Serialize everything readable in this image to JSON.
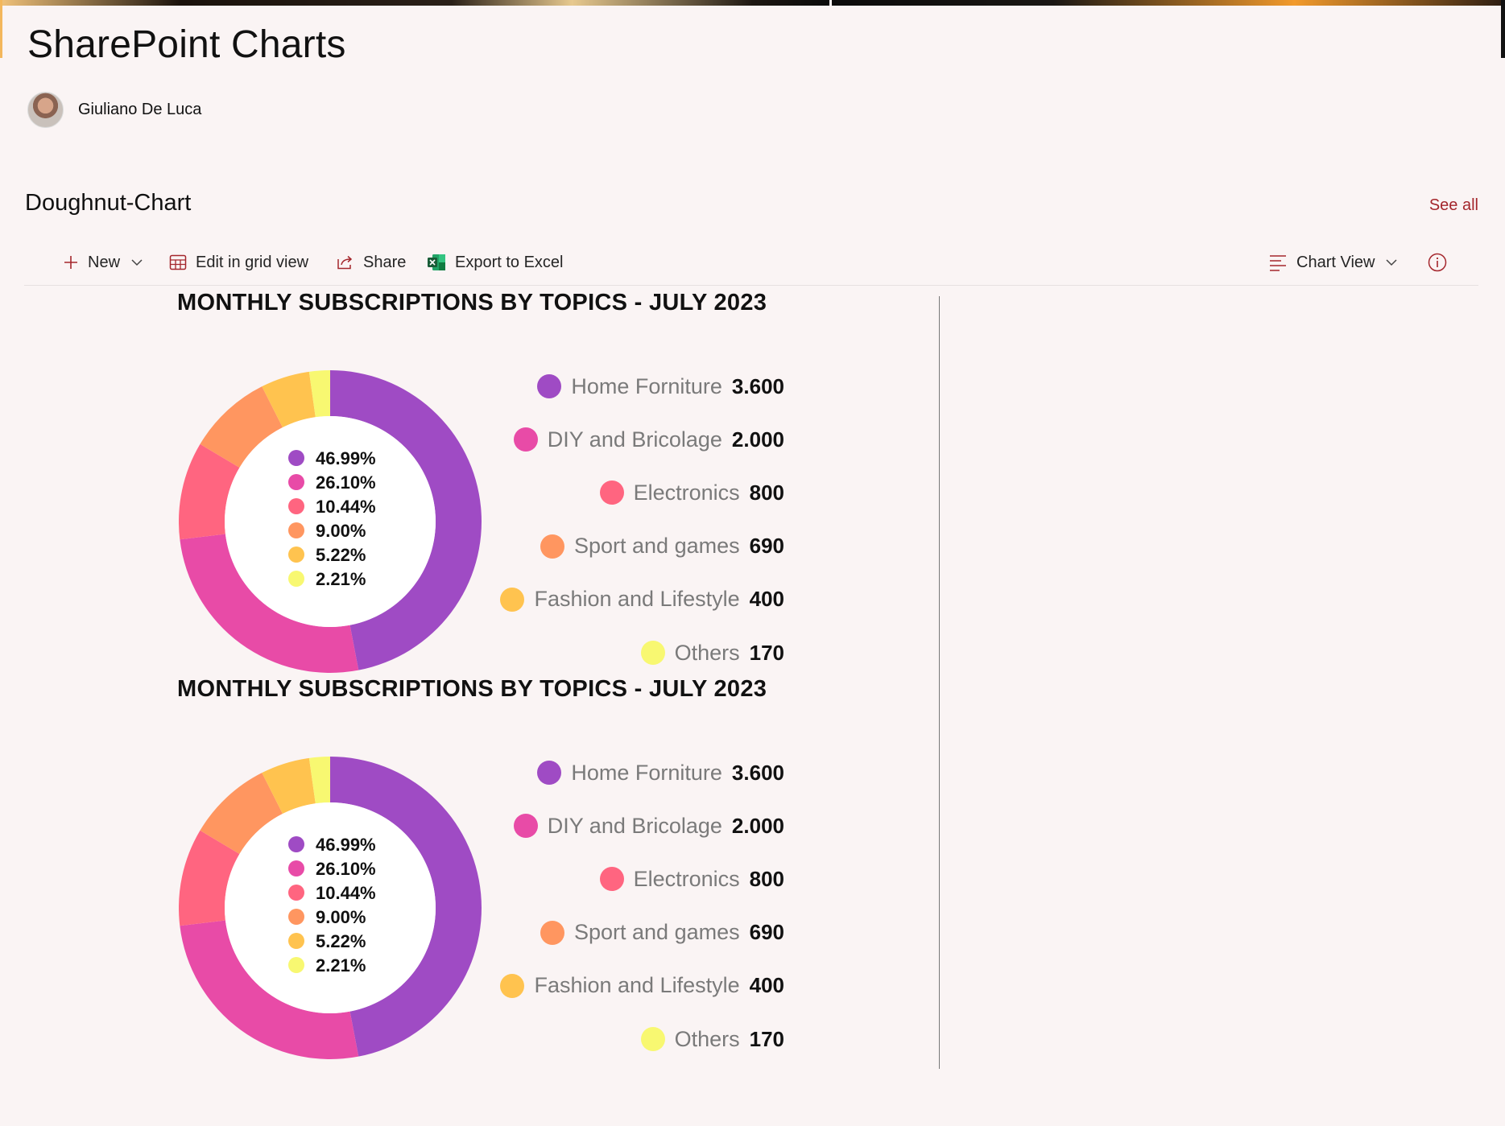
{
  "page": {
    "title": "SharePoint Charts",
    "author": "Giuliano De Luca"
  },
  "section": {
    "title": "Doughnut-Chart",
    "see_all": "See all"
  },
  "toolbar": {
    "new_label": "New",
    "edit_grid_label": "Edit in grid view",
    "share_label": "Share",
    "export_label": "Export to Excel",
    "view_label": "Chart View"
  },
  "icons": {
    "new": "plus-icon",
    "edit_grid": "grid-icon",
    "share": "share-icon",
    "export": "excel-icon",
    "view": "list-lines-icon",
    "info": "info-icon",
    "chevron": "chevron-down-icon"
  },
  "colors": {
    "accent": "#a4262c",
    "purple": "#9f4bc4",
    "magenta": "#e84ba7",
    "coral": "#ff6580",
    "orange": "#ff9660",
    "amber": "#ffc34f",
    "yellow": "#f8f871"
  },
  "chart_data": [
    {
      "type": "doughnut",
      "title": "MONTHLY SUBSCRIPTIONS BY TOPICS - JULY 2023",
      "categories": [
        "Home Forniture",
        "DIY and Bricolage",
        "Electronics",
        "Sport and games",
        "Fashion and Lifestyle",
        "Others"
      ],
      "values": [
        3600,
        2000,
        800,
        690,
        400,
        170
      ],
      "value_labels": [
        "3.600",
        "2.000",
        "800",
        "690",
        "400",
        "170"
      ],
      "percent_labels": [
        "46.99%",
        "26.10%",
        "10.44%",
        "9.00%",
        "5.22%",
        "2.21%"
      ],
      "colors": [
        "#9f4bc4",
        "#e84ba7",
        "#ff6580",
        "#ff9660",
        "#ffc34f",
        "#f8f871"
      ],
      "legend": "right"
    },
    {
      "type": "doughnut",
      "title": "MONTHLY SUBSCRIPTIONS BY TOPICS - JULY 2023",
      "categories": [
        "Home Forniture",
        "DIY and Bricolage",
        "Electronics",
        "Sport and games",
        "Fashion and Lifestyle",
        "Others"
      ],
      "values": [
        3600,
        2000,
        800,
        690,
        400,
        170
      ],
      "value_labels": [
        "3.600",
        "2.000",
        "800",
        "690",
        "400",
        "170"
      ],
      "percent_labels": [
        "46.99%",
        "26.10%",
        "10.44%",
        "9.00%",
        "5.22%",
        "2.21%"
      ],
      "colors": [
        "#9f4bc4",
        "#e84ba7",
        "#ff6580",
        "#ff9660",
        "#ffc34f",
        "#f8f871"
      ],
      "legend": "right"
    }
  ]
}
